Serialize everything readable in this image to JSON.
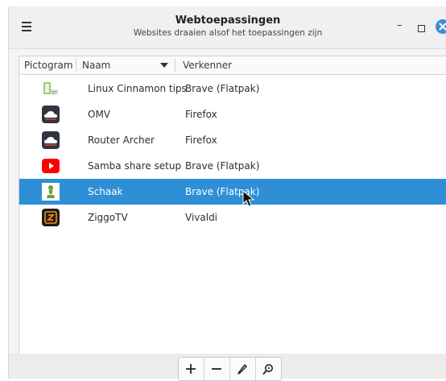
{
  "window": {
    "title": "Webtoepassingen",
    "subtitle": "Websites draaien alsof het toepassingen zijn",
    "menu_icon": "hamburger-menu-icon",
    "controls": [
      "minimize-icon",
      "maximize-icon",
      "close-icon"
    ],
    "accent_color": "#3d8fd6"
  },
  "columns": {
    "icon": "Pictogram",
    "name": "Naam",
    "browser": "Verkenner",
    "sort_icon": "sort-descending-icon"
  },
  "apps": [
    {
      "name": "Linux Cinnamon tips",
      "browser": "Brave (Flatpak)",
      "icon": "document-text-icon",
      "selected": false
    },
    {
      "name": "OMV",
      "browser": "Firefox",
      "icon": "cloud-icon",
      "selected": false
    },
    {
      "name": "Router Archer",
      "browser": "Firefox",
      "icon": "cloud-icon",
      "selected": false
    },
    {
      "name": "Samba share setup",
      "browser": "Brave (Flatpak)",
      "icon": "youtube-play-icon",
      "selected": false
    },
    {
      "name": "Schaak",
      "browser": "Brave (Flatpak)",
      "icon": "chess-pawn-icon",
      "selected": true
    },
    {
      "name": "ZiggoTV",
      "browser": "Vivaldi",
      "icon": "ziggo-logo-icon",
      "selected": false
    }
  ],
  "selection_color": "#2e8fd6",
  "toolbar": {
    "buttons": [
      "add-icon",
      "remove-icon",
      "edit-icon",
      "run-icon"
    ]
  }
}
